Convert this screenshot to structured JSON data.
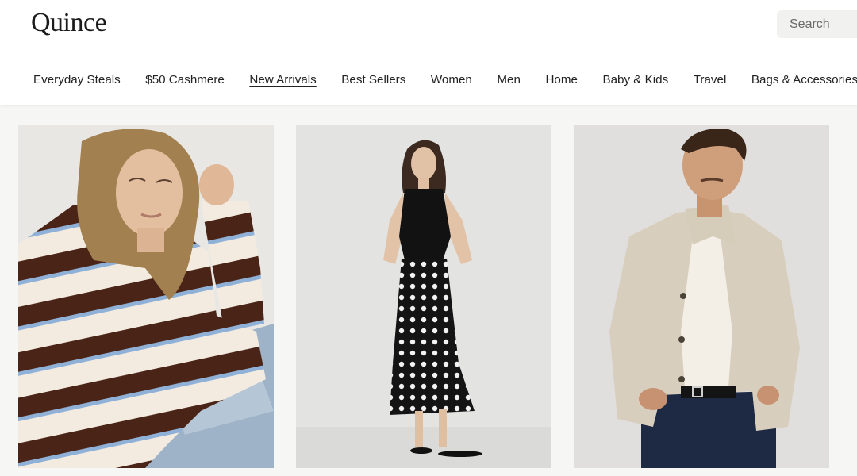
{
  "header": {
    "logo": "Quince",
    "search_placeholder": "Search"
  },
  "nav": {
    "items": [
      {
        "label": "Everyday Steals"
      },
      {
        "label": "$50 Cashmere"
      },
      {
        "label": "New Arrivals",
        "active": true
      },
      {
        "label": "Best Sellers"
      },
      {
        "label": "Women"
      },
      {
        "label": "Men"
      },
      {
        "label": "Home"
      },
      {
        "label": "Baby & Kids"
      },
      {
        "label": "Travel"
      },
      {
        "label": "Bags & Accessories"
      }
    ]
  },
  "products": [
    {
      "image": "woman-striped-rugby-sweater",
      "colors": {
        "bg": "#e7e5e2",
        "accent": "#4a2416"
      }
    },
    {
      "image": "woman-polka-dot-skirt-black-vest",
      "colors": {
        "bg": "#e2e2e0",
        "accent": "#151515"
      }
    },
    {
      "image": "man-beige-jacket-cable-knit",
      "colors": {
        "bg": "#dedddb",
        "accent": "#d9cfbd"
      }
    }
  ]
}
